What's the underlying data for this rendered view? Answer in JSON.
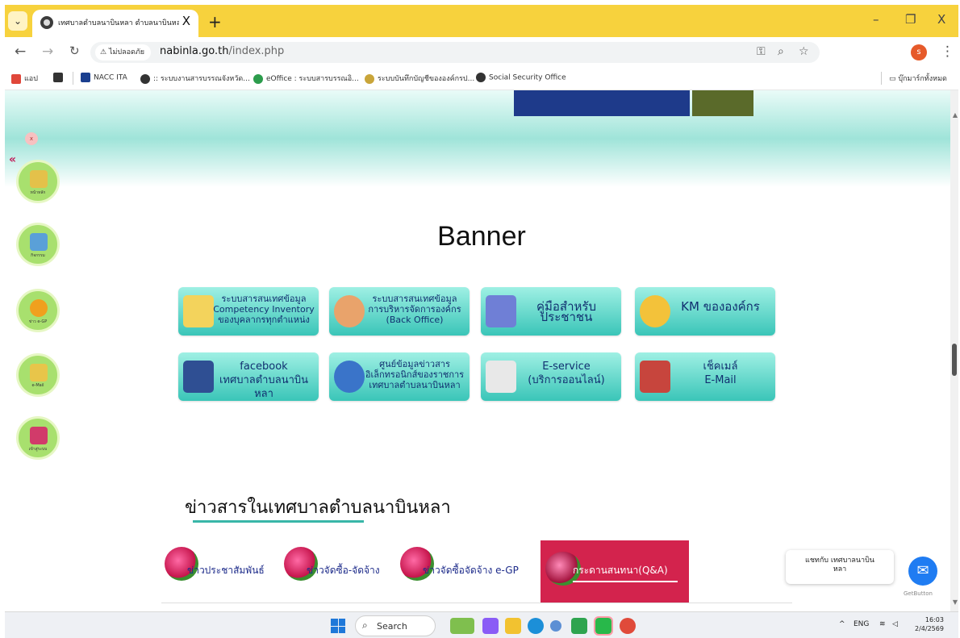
{
  "browser": {
    "tab_title": "เทศบาลตำบลนาบินหลา ตำบลนาบินหลา อำเ",
    "tab_close": "X",
    "new_tab": "+",
    "tab_menu": "⌄",
    "window_controls": {
      "minimize": "–",
      "restore": "❐",
      "close": "X"
    },
    "security_label": "ไม่ปลอดภัย",
    "url_domain": "nabinla.go.th",
    "url_path": "/index.php",
    "profile_initial": "s",
    "bookmarks": [
      {
        "label": "แอป",
        "icon": "apps-grid-icon"
      },
      {
        "label": "",
        "icon": "grid-icon"
      },
      {
        "label": "NACC ITA",
        "icon": "ita-logo-icon"
      },
      {
        "label": ":: ระบบงานสารบรรณจังหวัด...",
        "icon": "globe-icon"
      },
      {
        "label": "eOffice : ระบบสารบรรณอิ...",
        "icon": "eoffice-icon"
      },
      {
        "label": "ระบบบันทึกบัญชีขององค์กรป...",
        "icon": "seal-icon"
      },
      {
        "label": "Social Security Office",
        "icon": "globe-icon"
      }
    ],
    "bookmarks_folder": "บุ๊กมาร์กทั้งหมด"
  },
  "page": {
    "sidebar": [
      {
        "label": "หน้าหลัก",
        "icon": "home-icon",
        "color": "#e4c14a"
      },
      {
        "label": "กิจกรรม",
        "icon": "activity-photo-icon",
        "color": "#5aa0d8"
      },
      {
        "label": "ข่าว e-GP",
        "icon": "egp-coin-icon",
        "color": "#f0a01e"
      },
      {
        "label": "e-Mail",
        "icon": "email-doc-icon",
        "color": "#e8c54a"
      },
      {
        "label": "เข้าสู่ระบบ",
        "icon": "login-door-icon",
        "color": "#d13b6a"
      }
    ],
    "banner_heading": "Banner",
    "banners": [
      {
        "text": "ระบบสารสนเทศข้อมูล\nCompetency Inventory\nของบุคลากรทุกตำแหน่ง",
        "icon": "competency-doc-icon",
        "color": "#f3d35c"
      },
      {
        "text": "ระบบสารสนเทศข้อมูล\nการบริหารจัดการองค์กร\n(Back Office)",
        "icon": "people-group-icon",
        "color": "#e9a36b"
      },
      {
        "text": "คู่มือสำหรับประชาชน",
        "icon": "manual-book-icon",
        "color": "#6f7fd6"
      },
      {
        "text": "KM ขององค์กร",
        "icon": "km-gear-hand-icon",
        "color": "#f3c23a"
      },
      {
        "text": "facebook\nเทศบาลตำบลนาบินหลา",
        "icon": "facebook-icon",
        "color": "#2f4f93"
      },
      {
        "text": "ศูนย์ข้อมูลข่าวสาร\nอิเล็กทรอนิกส์ของราชการ\nเทศบาลตำบลนาบินหลา",
        "icon": "www-globe-icon",
        "color": "#3a74c9"
      },
      {
        "text": "E-service\n(บริการออนไลน์)",
        "icon": "eservice-form-icon",
        "color": "#e8e8e8"
      },
      {
        "text": "เช็คเมล์\nE-Mail",
        "icon": "mail-envelope-icon",
        "color": "#c7453d"
      }
    ],
    "news_heading": "ข่าวสารในเทศบาลตำบลนาบินหลา",
    "news_tabs": [
      "ข่าวประชาสัมพันธ์",
      "ข่าวจัดซื้อ-จัดจ้าง",
      "ข่าวจัดซื้อจัดจ้าง e-GP",
      "กระดานสนทนา(Q&A)"
    ],
    "chat_text": "แชทกับ เทศบาลนาบิน\nหลา",
    "getbutton": "GetButton"
  },
  "taskbar": {
    "search": "Search",
    "tray_lang": "ENG",
    "time": "16:03",
    "date": "2/4/2569"
  }
}
